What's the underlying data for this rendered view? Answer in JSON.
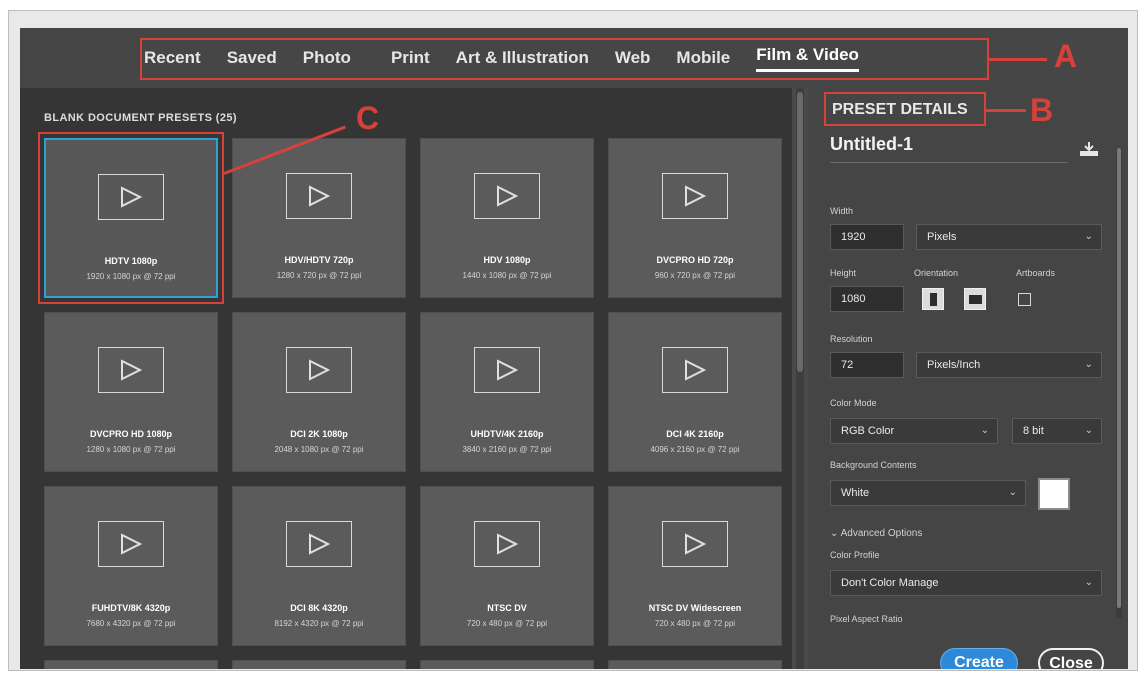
{
  "nav": {
    "tabs": [
      "Recent",
      "Saved",
      "Photo",
      "Print",
      "Art & Illustration",
      "Web",
      "Mobile",
      "Film & Video"
    ],
    "active_tab": "Film & Video"
  },
  "callouts": {
    "a": "A",
    "b": "B",
    "c": "C"
  },
  "presets": {
    "title": "BLANK DOCUMENT PRESETS",
    "count": "(25)",
    "items": [
      {
        "name": "HDTV 1080p",
        "dims": "1920 x 1080 px @ 72 ppi"
      },
      {
        "name": "HDV/HDTV 720p",
        "dims": "1280 x 720 px @ 72 ppi"
      },
      {
        "name": "HDV 1080p",
        "dims": "1440 x 1080 px @ 72 ppi"
      },
      {
        "name": "DVCPRO HD 720p",
        "dims": "960 x 720 px @ 72 ppi"
      },
      {
        "name": "DVCPRO HD 1080p",
        "dims": "1280 x 1080 px @ 72 ppi"
      },
      {
        "name": "DCI 2K 1080p",
        "dims": "2048 x 1080 px @ 72 ppi"
      },
      {
        "name": "UHDTV/4K 2160p",
        "dims": "3840 x 2160 px @ 72 ppi"
      },
      {
        "name": "DCI 4K 2160p",
        "dims": "4096 x 2160 px @ 72 ppi"
      },
      {
        "name": "FUHDTV/8K 4320p",
        "dims": "7680 x 4320 px @ 72 ppi"
      },
      {
        "name": "DCI 8K 4320p",
        "dims": "8192 x 4320 px @ 72 ppi"
      },
      {
        "name": "NTSC DV",
        "dims": "720 x 480 px @ 72 ppi"
      },
      {
        "name": "NTSC DV Widescreen",
        "dims": "720 x 480 px @ 72 ppi"
      }
    ]
  },
  "details": {
    "title": "PRESET DETAILS",
    "doc_name": "Untitled-1",
    "width_label": "Width",
    "width_value": "1920",
    "width_unit": "Pixels",
    "height_label": "Height",
    "height_value": "1080",
    "orientation_label": "Orientation",
    "artboards_label": "Artboards",
    "resolution_label": "Resolution",
    "resolution_value": "72",
    "resolution_unit": "Pixels/Inch",
    "color_mode_label": "Color Mode",
    "color_mode_value": "RGB Color",
    "bit_depth": "8 bit",
    "background_label": "Background Contents",
    "background_value": "White",
    "advanced_label": "Advanced Options",
    "color_profile_label": "Color Profile",
    "color_profile_value": "Don't Color Manage",
    "pixel_aspect_label": "Pixel Aspect Ratio",
    "create_label": "Create",
    "close_label": "Close"
  },
  "icons": [
    "play-icon",
    "save-preset-icon",
    "chevron-down-icon",
    "portrait-icon",
    "landscape-icon"
  ],
  "colors": {
    "accent": "#2e8ad8",
    "callout": "#d6423a",
    "selected_border": "#2fa0d6"
  }
}
